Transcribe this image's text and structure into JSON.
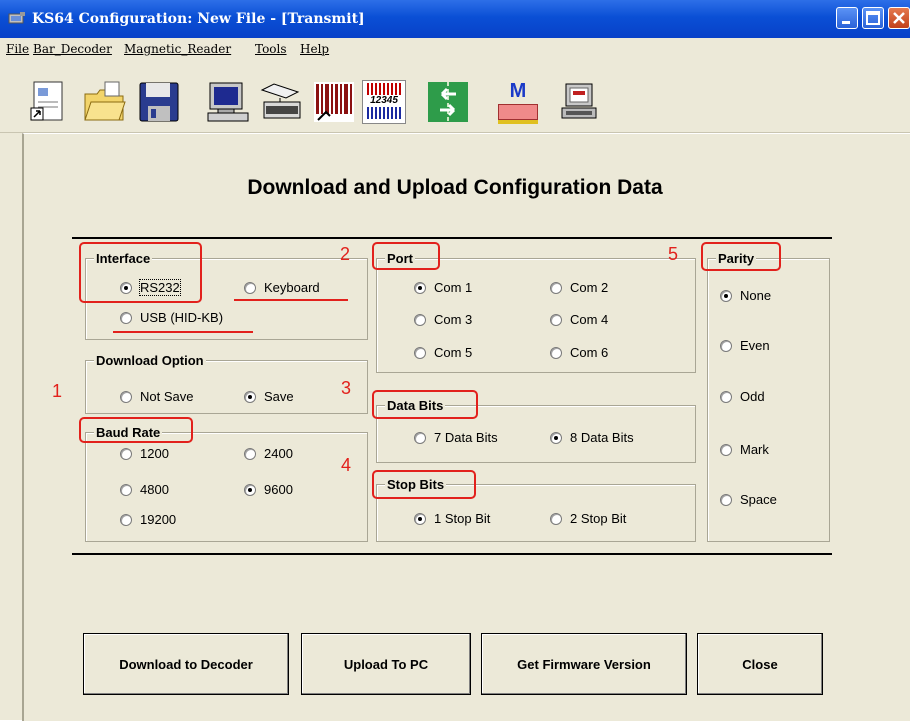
{
  "window": {
    "title": "KS64 Configuration: New File - [Transmit]"
  },
  "menu": {
    "items": [
      "File",
      "Bar_Decoder",
      "Magnetic_Reader",
      "Tools",
      "Help"
    ]
  },
  "toolbar": {
    "icons": [
      "new-file-icon",
      "open-folder-icon",
      "save-disk-icon",
      "computer-icon",
      "keyboard-wedge-icon",
      "barcode-icon",
      "barcode-numbers-icon",
      "transmit-arrows-icon",
      "magnetic-card-icon",
      "terminal-icon"
    ],
    "m_label": "M",
    "barcode_number": "12345"
  },
  "heading": "Download and Upload Configuration Data",
  "interface": {
    "label": "Interface",
    "options": [
      "RS232",
      "Keyboard",
      "USB (HID-KB)"
    ],
    "selected": "RS232"
  },
  "download_option": {
    "label": "Download Option",
    "options": [
      "Not Save",
      "Save"
    ],
    "selected": "Save"
  },
  "baud_rate": {
    "label": "Baud Rate",
    "options": [
      "1200",
      "2400",
      "4800",
      "9600",
      "19200"
    ],
    "selected": "9600"
  },
  "port": {
    "label": "Port",
    "options": [
      "Com 1",
      "Com 2",
      "Com 3",
      "Com 4",
      "Com 5",
      "Com 6"
    ],
    "selected": "Com 1"
  },
  "data_bits": {
    "label": "Data Bits",
    "options": [
      "7 Data Bits",
      "8 Data Bits"
    ],
    "selected": "8 Data Bits"
  },
  "stop_bits": {
    "label": "Stop Bits",
    "options": [
      "1 Stop Bit",
      "2 Stop Bit"
    ],
    "selected": "1 Stop Bit"
  },
  "parity": {
    "label": "Parity",
    "options": [
      "None",
      "Even",
      "Odd",
      "Mark",
      "Space"
    ],
    "selected": "None"
  },
  "annotations": {
    "n1": "1",
    "n2": "2",
    "n3": "3",
    "n4": "4",
    "n5": "5",
    "color": "#e2211c"
  },
  "buttons": {
    "download": "Download to Decoder",
    "upload": "Upload To PC",
    "firmware": "Get Firmware Version",
    "close": "Close"
  }
}
